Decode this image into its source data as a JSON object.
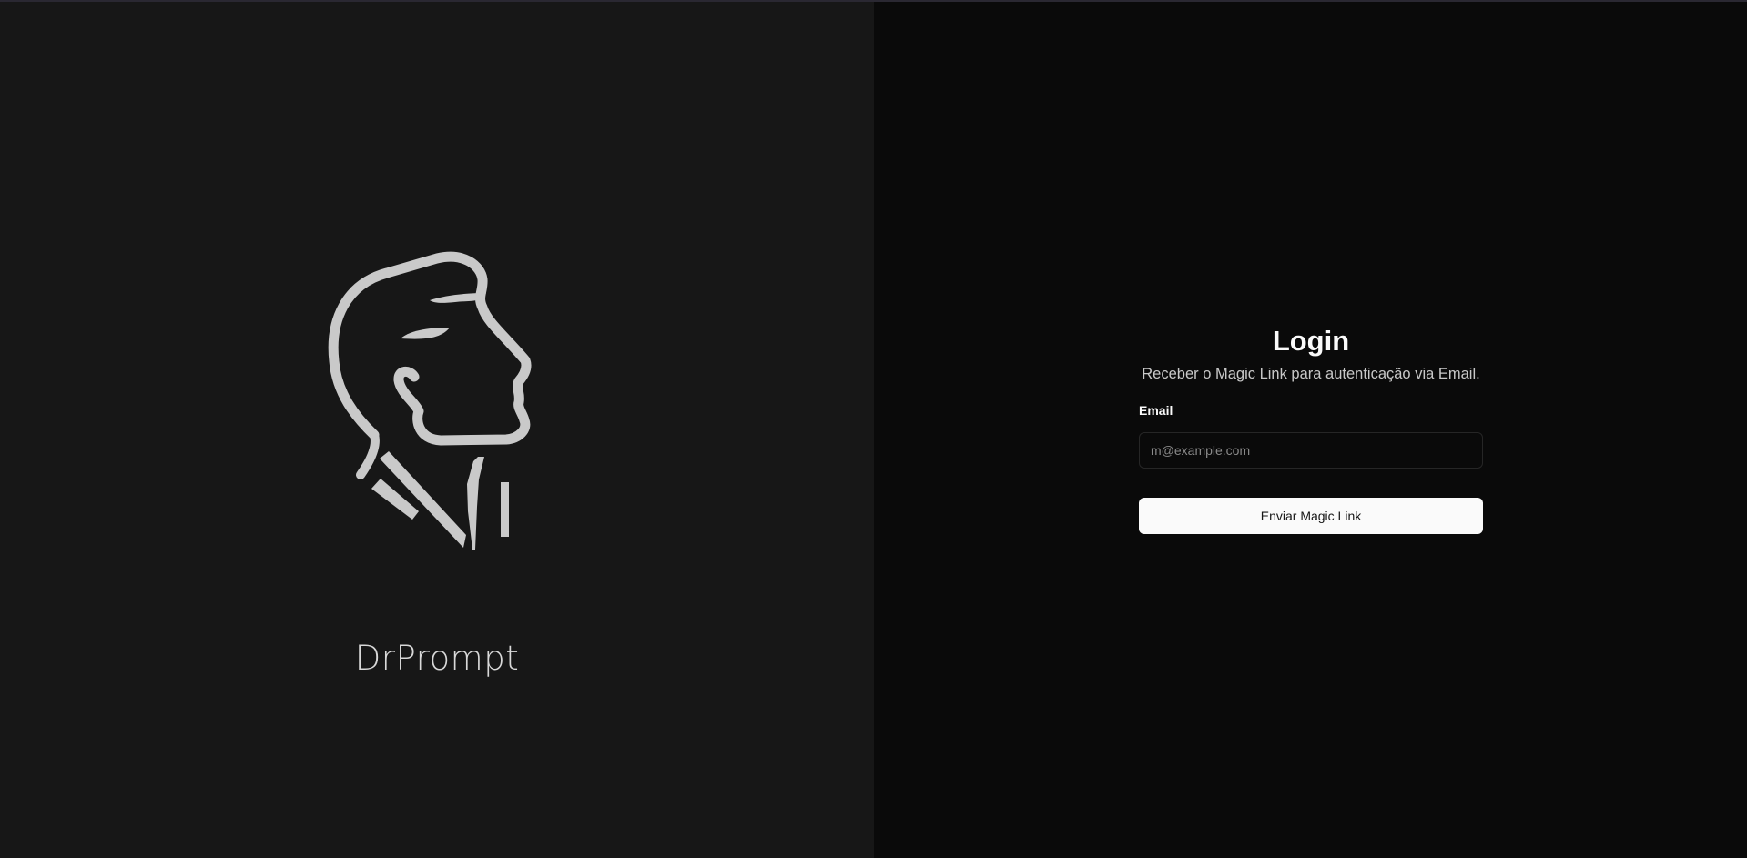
{
  "brand": {
    "logo_icon": "man-profile-head-icon",
    "name": "DrPrompt"
  },
  "login": {
    "title": "Login",
    "subtitle": "Receber o Magic Link para autenticação via Email.",
    "email_label": "Email",
    "email_placeholder": "m@example.com",
    "email_value": "",
    "submit_label": "Enviar Magic Link"
  },
  "colors": {
    "left_panel_bg": "#171717",
    "right_panel_bg": "#0a0a0a",
    "logo_stroke": "#c9c9c9",
    "button_bg": "#fafafa",
    "button_text": "#171717"
  }
}
